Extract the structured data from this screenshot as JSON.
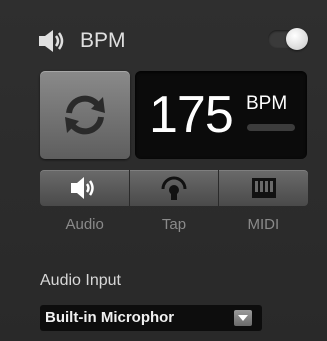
{
  "header": {
    "title": "BPM",
    "icon": "speaker-icon",
    "toggle_state": "on"
  },
  "sync": {
    "icon": "sync-icon"
  },
  "bpm_display": {
    "value": "175",
    "unit": "BPM"
  },
  "modes": [
    {
      "label": "Audio",
      "icon": "speaker-icon",
      "selected": true
    },
    {
      "label": "Tap",
      "icon": "tap-icon",
      "selected": false
    },
    {
      "label": "MIDI",
      "icon": "midi-keyboard-icon",
      "selected": false
    }
  ],
  "audio_input": {
    "label": "Audio Input",
    "selected": "Built-in Microphor"
  },
  "colors": {
    "background": "#2b2b2b",
    "display_bg": "#0b0b0b",
    "button": "#6a6a6a"
  }
}
